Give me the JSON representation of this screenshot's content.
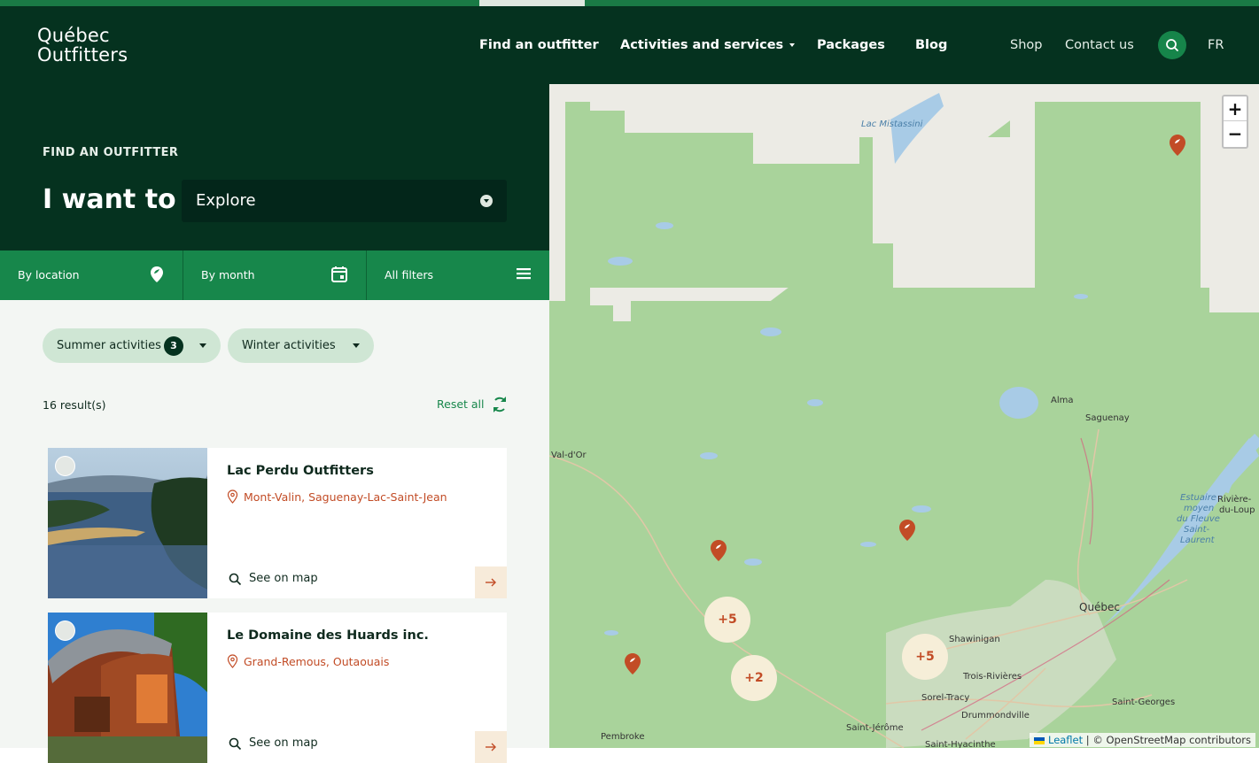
{
  "brand": {
    "line1": "Québec",
    "line2": "Outfitters"
  },
  "nav": {
    "find": "Find an outfitter",
    "activities": "Activities and services",
    "packages": "Packages",
    "blog": "Blog",
    "shop": "Shop",
    "contact": "Contact us",
    "lang": "FR"
  },
  "hero": {
    "eyebrow": "FIND AN OUTFITTER",
    "iwant": "I want to",
    "select_value": "Explore"
  },
  "filters": {
    "location": "By location",
    "month": "By month",
    "all": "All filters"
  },
  "chips": [
    {
      "label": "Summer activities",
      "count": "3"
    },
    {
      "label": "Winter activities"
    }
  ],
  "results": {
    "count_label": "16 result(s)",
    "reset": "Reset all"
  },
  "cards": [
    {
      "title": "Lac Perdu Outfitters",
      "location": "Mont-Valin, Saguenay-Lac-Saint-Jean",
      "see_map": "See on map"
    },
    {
      "title": "Le Domaine des Huards inc.",
      "location": "Grand-Remous, Outaouais",
      "see_map": "See on map"
    }
  ],
  "map": {
    "zoom_in": "+",
    "zoom_out": "−",
    "clusters": [
      "+5",
      "+2",
      "+5"
    ],
    "labels": {
      "mistassini": "Lac Mistassini",
      "alma": "Alma",
      "saguenay": "Saguenay",
      "valdor": "Val-d'Or",
      "estuaire1": "Estuaire",
      "estuaire2": "moyen",
      "estuaire3": "du Fleuve",
      "estuaire4": "Saint-",
      "estuaire5": "Laurent",
      "riviere1": "Rivière-",
      "riviere2": "du-Loup",
      "quebec": "Québec",
      "shawinigan": "Shawinigan",
      "troisrivieres": "Trois-Rivières",
      "sorel": "Sorel-Tracy",
      "drummondville": "Drummondville",
      "stjerome": "Saint-Jérôme",
      "sthyacinthe": "Saint-Hyacinthe",
      "stgeorges": "Saint-Georges",
      "pembroke": "Pembroke"
    },
    "attribution": {
      "leaflet": "Leaflet",
      "osm": "| © OpenStreetMap contributors"
    }
  },
  "colors": {
    "dark_green": "#05321f",
    "green": "#17874b",
    "accent": "#c24c26",
    "chip": "#cfe6d4"
  }
}
